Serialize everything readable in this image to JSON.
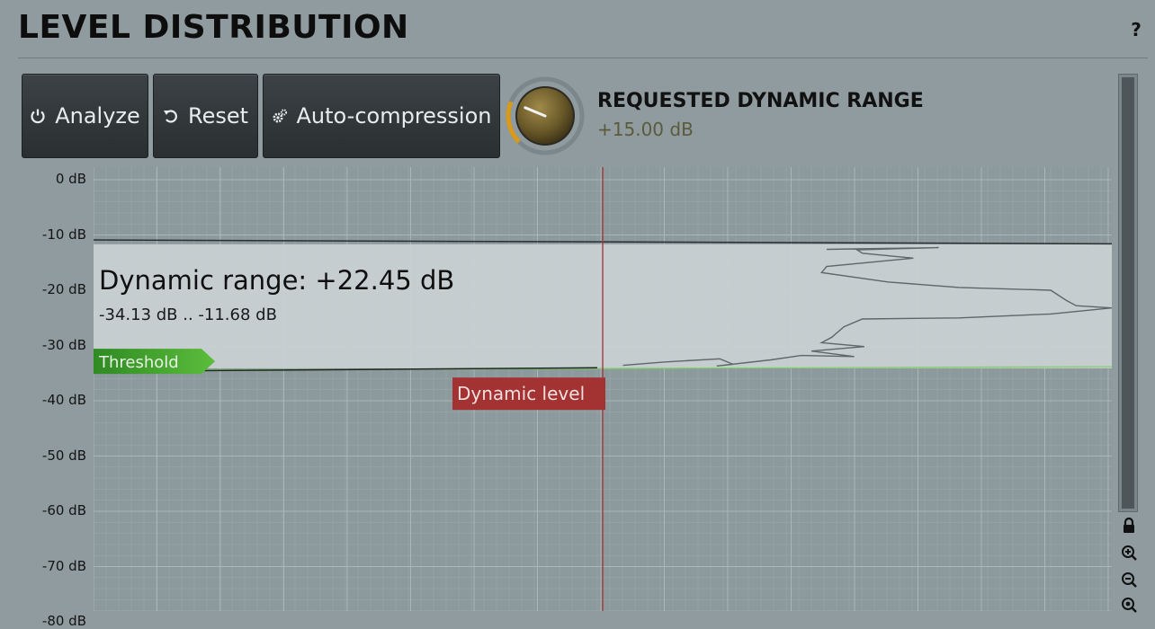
{
  "title": "LEVEL DISTRIBUTION",
  "help_label": "?",
  "buttons": {
    "analyze": "Analyze",
    "reset": "Reset",
    "auto": "Auto-compression"
  },
  "parameter": {
    "name": "REQUESTED DYNAMIC RANGE",
    "value": "+15.00 dB",
    "knob_fraction": 0.25
  },
  "y_axis": {
    "ticks": [
      "0 dB",
      "-10 dB",
      "-20 dB",
      "-30 dB",
      "-40 dB",
      "-50 dB",
      "-60 dB",
      "-70 dB",
      "-80 dB"
    ],
    "values": [
      0,
      -10,
      -20,
      -30,
      -40,
      -50,
      -60,
      -70,
      -80
    ],
    "range": [
      0,
      -80
    ]
  },
  "graph": {
    "dynamic_range_label": "Dynamic range: +22.45 dB",
    "range_values_label": "-34.13 dB .. -11.68 dB",
    "range_top_db": -11.68,
    "range_bottom_db": -34.13,
    "threshold_label": "Threshold",
    "threshold_db": -34.5,
    "dynamic_level_label": "Dynamic level",
    "dynamic_level_fraction": 0.5
  },
  "colors": {
    "background": "#8f9b9f",
    "graph_bg": "#8c999d",
    "range_band": "#c9d1d3",
    "threshold": "#3e9e2f",
    "dynamic_level": "#a33232",
    "knob_ring": "#d89a1a"
  },
  "icons": {
    "analyze": "power-icon",
    "reset": "undo-icon",
    "auto": "gears-icon",
    "lock": "lock-icon",
    "zoom_in": "zoom-in-icon",
    "zoom_out": "zoom-out-icon",
    "zoom_reset": "zoom-reset-icon"
  }
}
